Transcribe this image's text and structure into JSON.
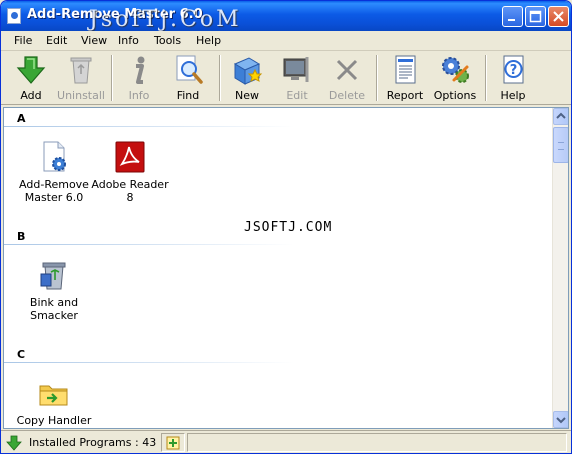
{
  "window": {
    "title": "Add-Remove Master 6.0"
  },
  "watermark": {
    "top": "JsofTj.CoM",
    "center": "JSOFTJ.COM"
  },
  "menu": [
    {
      "id": "file",
      "label": "File"
    },
    {
      "id": "edit",
      "label": "Edit"
    },
    {
      "id": "view",
      "label": "View"
    },
    {
      "id": "info",
      "label": "Info"
    },
    {
      "id": "tools",
      "label": "Tools"
    },
    {
      "id": "help",
      "label": "Help"
    }
  ],
  "toolbar": {
    "add": {
      "label": "Add",
      "icon": "green-down-arrow-icon",
      "enabled": true
    },
    "uninstall": {
      "label": "Uninstall",
      "icon": "recycle-bin-icon",
      "enabled": false
    },
    "info": {
      "label": "Info",
      "icon": "info-icon",
      "enabled": false
    },
    "find": {
      "label": "Find",
      "icon": "magnifier-icon",
      "enabled": true
    },
    "new": {
      "label": "New",
      "icon": "new-program-icon",
      "enabled": true
    },
    "edit": {
      "label": "Edit",
      "icon": "monitor-edit-icon",
      "enabled": false
    },
    "delete": {
      "label": "Delete",
      "icon": "delete-x-icon",
      "enabled": false
    },
    "report": {
      "label": "Report",
      "icon": "report-document-icon",
      "enabled": true
    },
    "options": {
      "label": "Options",
      "icon": "gears-icon",
      "enabled": true
    },
    "help": {
      "label": "Help",
      "icon": "help-question-icon",
      "enabled": true
    }
  },
  "groups": [
    {
      "letter": "A",
      "programs": [
        {
          "name": "Add-Remove Master 6.0",
          "icon": "document-gear-icon"
        },
        {
          "name": "Adobe Reader 8",
          "icon": "adobe-reader-icon"
        }
      ]
    },
    {
      "letter": "B",
      "programs": [
        {
          "name": "Bink and Smacker",
          "icon": "recycle-bin-box-icon"
        }
      ]
    },
    {
      "letter": "C",
      "programs": [
        {
          "name": "Copy Handler",
          "icon": "folder-copy-icon"
        }
      ]
    }
  ],
  "status": {
    "text": "Installed Programs : 43"
  },
  "colors": {
    "title_bar": "#0a50d8",
    "accent_green": "#3aa635",
    "adobe_red": "#c40f0f"
  }
}
